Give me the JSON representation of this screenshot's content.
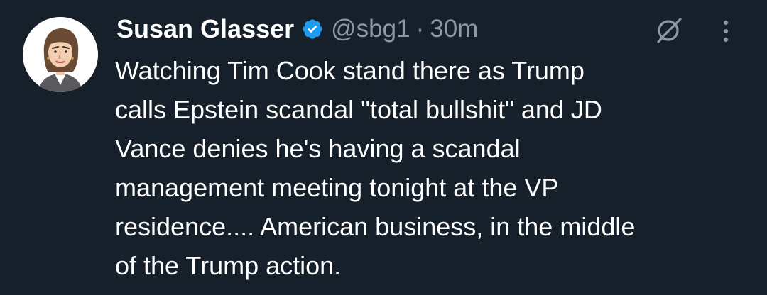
{
  "tweet": {
    "author_name": "Susan Glasser",
    "handle": "@sbg1",
    "separator": "·",
    "timestamp": "30m",
    "text": "Watching Tim Cook stand there as Trump\ncalls Epstein scandal \"total bullshit\" and JD\nVance denies he's having a scandal\nmanagement meeting tonight at the VP\nresidence.... American business, in the middle\nof the Trump action."
  },
  "icons": {
    "verified": "verified-badge-icon",
    "grok": "grok-icon",
    "more": "more-options-icon"
  },
  "colors": {
    "background": "#15202b",
    "text": "#ffffff",
    "secondary_text": "#8b98a5",
    "verified_blue": "#1d9bf0"
  }
}
